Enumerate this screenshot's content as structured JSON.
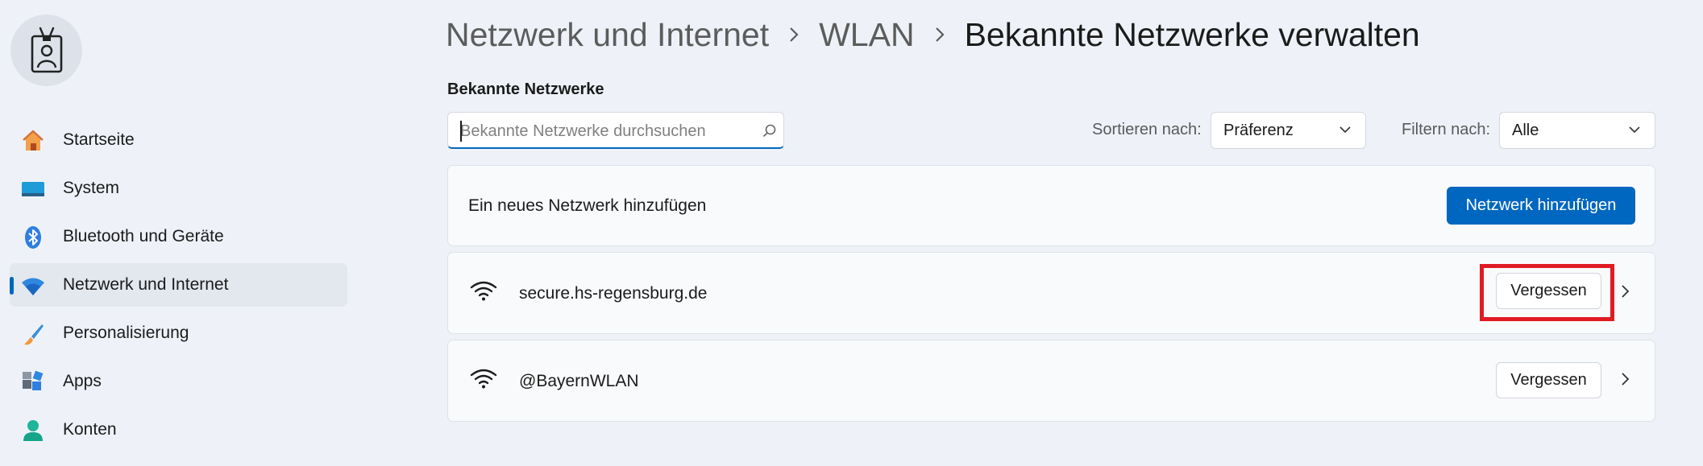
{
  "sidebar": {
    "items": [
      {
        "label": "Startseite",
        "icon": "home-icon"
      },
      {
        "label": "System",
        "icon": "system-display-icon"
      },
      {
        "label": "Bluetooth und Geräte",
        "icon": "bluetooth-icon"
      },
      {
        "label": "Netzwerk und Internet",
        "icon": "wifi-network-icon",
        "selected": true
      },
      {
        "label": "Personalisierung",
        "icon": "paintbrush-icon"
      },
      {
        "label": "Apps",
        "icon": "apps-icon"
      },
      {
        "label": "Konten",
        "icon": "account-icon"
      }
    ]
  },
  "breadcrumb": {
    "level1": "Netzwerk und Internet",
    "level2": "WLAN",
    "current": "Bekannte Netzwerke verwalten"
  },
  "main": {
    "section_title": "Bekannte Netzwerke",
    "search": {
      "placeholder": "Bekannte Netzwerke durchsuchen",
      "value": ""
    },
    "sort": {
      "label": "Sortieren nach:",
      "value": "Präferenz"
    },
    "filter": {
      "label": "Filtern nach:",
      "value": "Alle"
    },
    "add_network": {
      "text": "Ein neues Netzwerk hinzufügen",
      "button_label": "Netzwerk hinzufügen"
    },
    "networks": [
      {
        "name": "secure.hs-regensburg.de",
        "forget_label": "Vergessen"
      },
      {
        "name": "@BayernWLAN",
        "forget_label": "Vergessen"
      }
    ]
  },
  "colors": {
    "accent": "#0067c0",
    "highlight": "#e01b24",
    "background": "#eef2f8"
  }
}
